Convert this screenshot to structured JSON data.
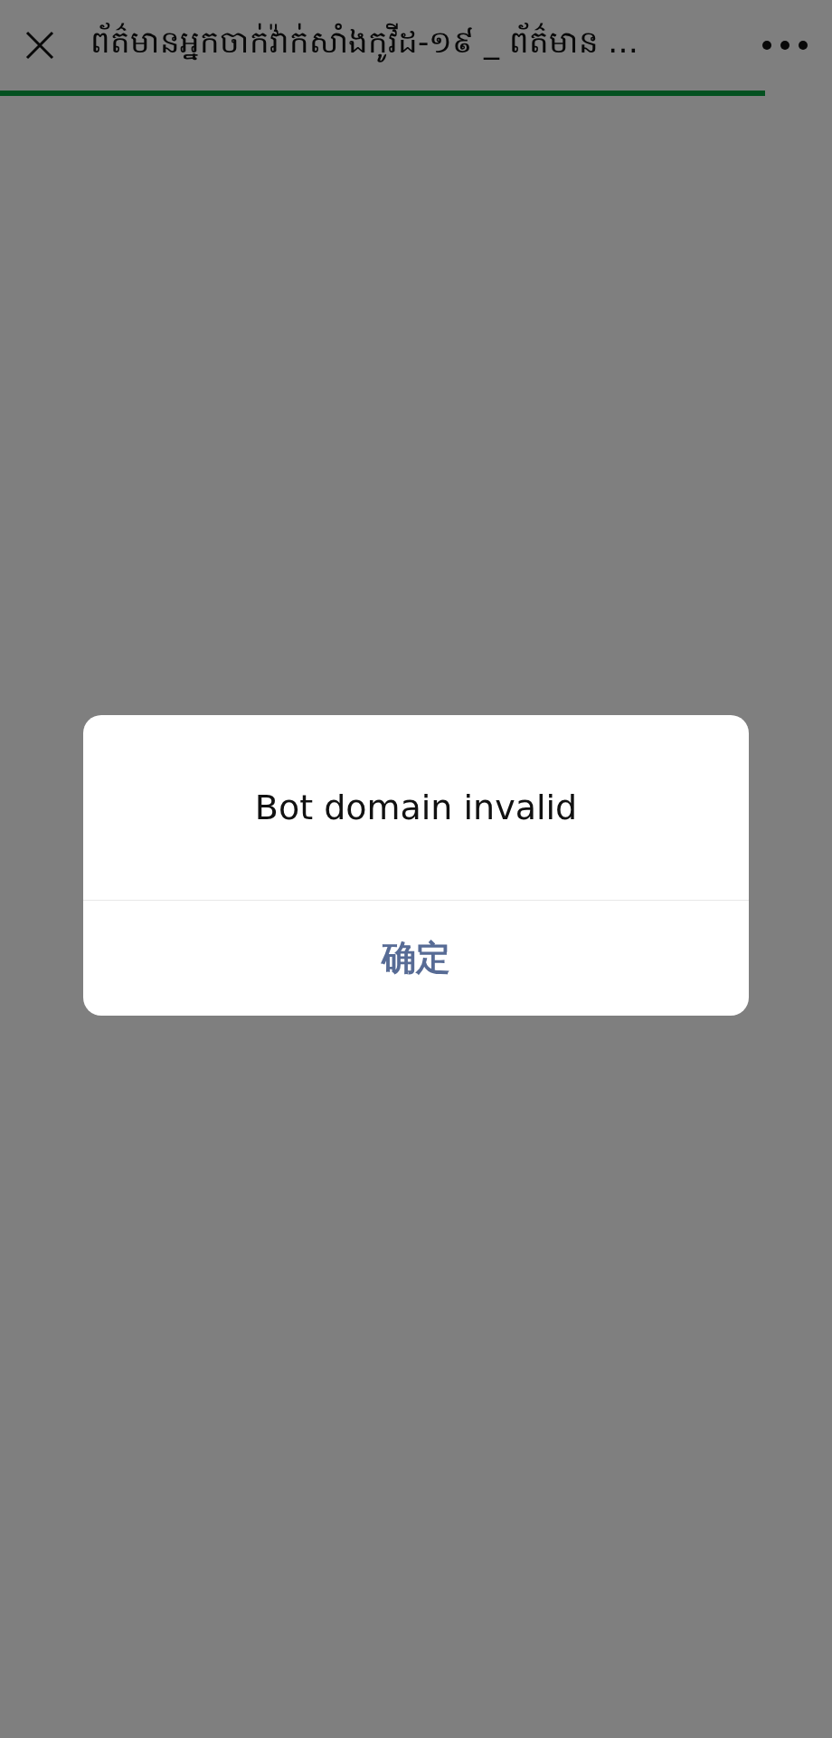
{
  "top_bar": {
    "title": "ព័ត៌មានអ្នកចាក់វ៉ាក់សាំងកូវីដ-១៩ _ ព័ត៌មាន",
    "title_ellipsis": "…",
    "loading": {
      "level": 0.92
    }
  },
  "dialog": {
    "message": "Bot domain invalid",
    "buttons": [
      {
        "label": "确定"
      }
    ]
  }
}
